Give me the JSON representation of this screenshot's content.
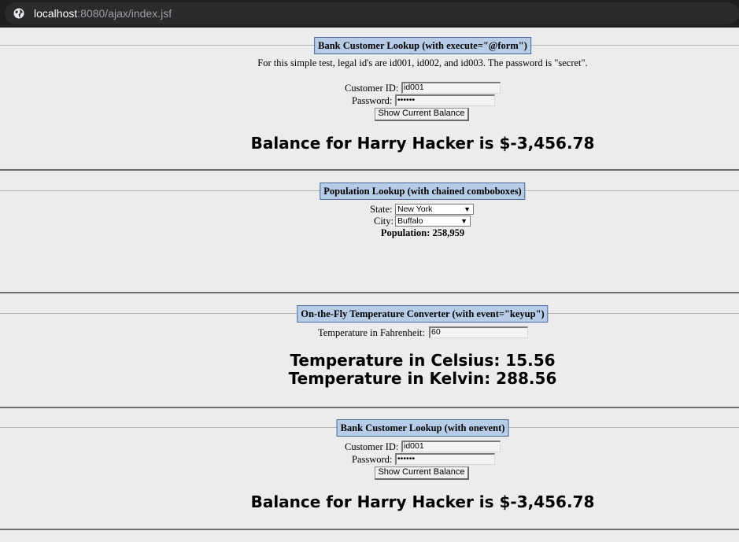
{
  "browser": {
    "url_host": "localhost",
    "url_path": ":8080/ajax/index.jsf"
  },
  "bank1": {
    "title": "Bank Customer Lookup (with execute=\"@form\")",
    "note": "For this simple test, legal id's are id001, id002, and id003. The password is \"secret\".",
    "customer_id_label": "Customer ID:",
    "customer_id_value": "id001",
    "password_label": "Password:",
    "password_value": "••••••",
    "button_label": "Show Current Balance",
    "result": "Balance for Harry Hacker is $-3,456.78"
  },
  "population": {
    "title": "Population Lookup (with chained comboboxes)",
    "state_label": "State:",
    "state_value": "New York",
    "city_label": "City:",
    "city_value": "Buffalo",
    "result": "Population: 258,959"
  },
  "temperature": {
    "title": "On-the-Fly Temperature Converter (with event=\"keyup\")",
    "input_label": "Temperature in Fahrenheit:",
    "input_value": "60",
    "celsius": "Temperature in Celsius: 15.56",
    "kelvin": "Temperature in Kelvin: 288.56"
  },
  "bank2": {
    "title": "Bank Customer Lookup (with onevent)",
    "customer_id_label": "Customer ID:",
    "customer_id_value": "id001",
    "password_label": "Password:",
    "password_value": "••••••",
    "button_label": "Show Current Balance",
    "result": "Balance for Harry Hacker is $-3,456.78"
  },
  "icons": {
    "site_info": "globe-icon",
    "select_arrow": "triangle-down-icon"
  },
  "colors": {
    "legend_bg": "#b7cce6",
    "legend_border": "#4a6896",
    "page_bg": "#ececec"
  }
}
